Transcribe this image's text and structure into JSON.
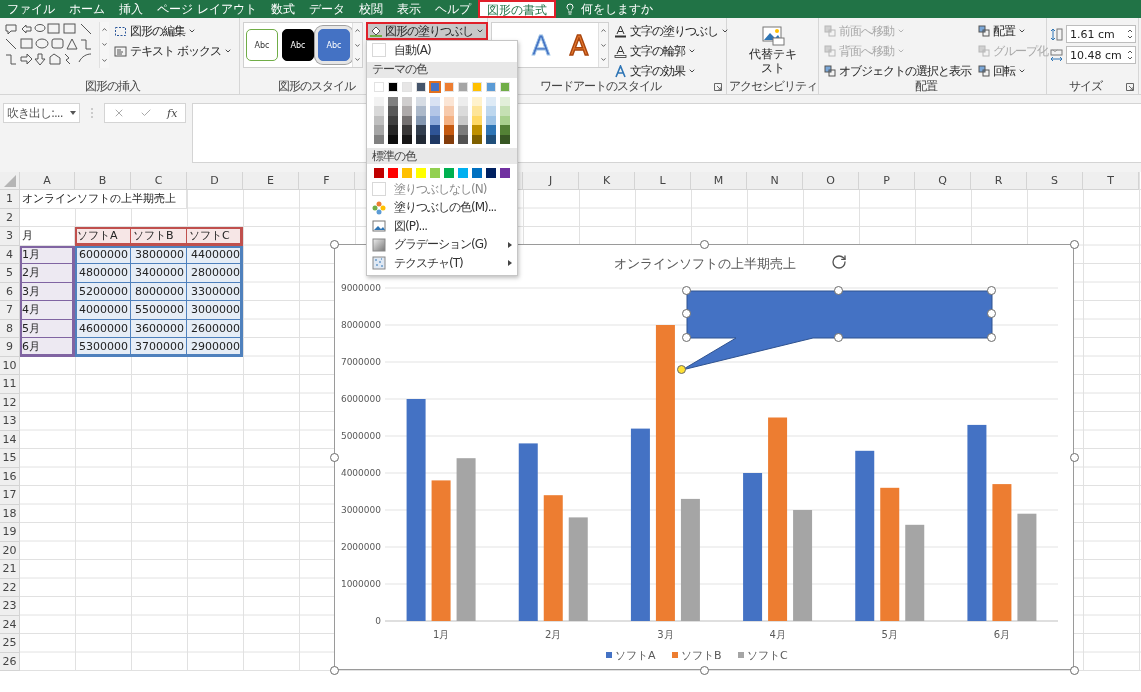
{
  "tabs": [
    {
      "label": "ファイル",
      "selected": false
    },
    {
      "label": "ホーム",
      "selected": false
    },
    {
      "label": "挿入",
      "selected": false
    },
    {
      "label": "ページ レイアウト",
      "selected": false
    },
    {
      "label": "数式",
      "selected": false
    },
    {
      "label": "データ",
      "selected": false
    },
    {
      "label": "校閲",
      "selected": false
    },
    {
      "label": "表示",
      "selected": false
    },
    {
      "label": "ヘルプ",
      "selected": false
    },
    {
      "label": "図形の書式",
      "selected": true
    }
  ],
  "tell_me": "何をしますか",
  "ribbon": {
    "insert_shapes": {
      "label": "図形の挿入",
      "commands": [
        "図形の編集",
        "テキスト ボックス"
      ]
    },
    "shape_styles": {
      "label": "図形のスタイル",
      "presets": [
        {
          "text": "Abc",
          "color": "#ffffff",
          "selected": false
        },
        {
          "text": "Abc",
          "color": "#000000",
          "selected": false
        },
        {
          "text": "Abc",
          "color": "#4472c4",
          "selected": true
        }
      ],
      "fill_button": {
        "label": "図形の塗りつぶし",
        "open": true
      }
    },
    "wordart": {
      "label": "ワードアートのスタイル",
      "presets": [
        {
          "text": "A",
          "kind": "fill",
          "color": "#4472c4"
        },
        {
          "text": "A",
          "kind": "outline",
          "color": "#ed7d31"
        }
      ],
      "commands": [
        "文字の塗りつぶし",
        "文字の輪郭",
        "文字の効果"
      ]
    },
    "accessibility": {
      "label": "アクセシビリティ",
      "button": "代替テキスト"
    },
    "arrange": {
      "label": "配置",
      "commands": [
        {
          "label": "前面へ移動",
          "disabled": true,
          "dropdown": true
        },
        {
          "label": "背面へ移動",
          "disabled": true,
          "dropdown": true
        },
        {
          "label": "オブジェクトの選択と表示",
          "disabled": false,
          "dropdown": false
        },
        {
          "label": "配置",
          "disabled": false,
          "dropdown": true
        },
        {
          "label": "グループ化",
          "disabled": true,
          "dropdown": true
        },
        {
          "label": "回転",
          "disabled": false,
          "dropdown": true
        }
      ]
    },
    "size": {
      "label": "サイズ",
      "height": "1.61 cm",
      "width": "10.48 cm"
    }
  },
  "formula_bar": {
    "name_box": "吹き出し:...",
    "function_label": "fx"
  },
  "fill_menu": {
    "auto": "自動(A)",
    "theme_heading": "テーマの色",
    "theme_colors": [
      {
        "color": "#ffffff",
        "selected": false,
        "shades": [
          {
            "color": "#f2f2f2"
          },
          {
            "color": "#d9d9d9"
          },
          {
            "color": "#bfbfbf"
          },
          {
            "color": "#a6a6a6"
          },
          {
            "color": "#808080"
          }
        ]
      },
      {
        "color": "#000000",
        "selected": false,
        "shades": [
          {
            "color": "#808080"
          },
          {
            "color": "#595959"
          },
          {
            "color": "#404040"
          },
          {
            "color": "#262626"
          },
          {
            "color": "#0d0d0d"
          }
        ]
      },
      {
        "color": "#e7e6e6",
        "selected": false,
        "shades": [
          {
            "color": "#d0cece"
          },
          {
            "color": "#aeaaaa"
          },
          {
            "color": "#757171"
          },
          {
            "color": "#3a3838"
          },
          {
            "color": "#171616"
          }
        ]
      },
      {
        "color": "#44546a",
        "selected": false,
        "shades": [
          {
            "color": "#d6dce4"
          },
          {
            "color": "#acb9ca"
          },
          {
            "color": "#8497b0"
          },
          {
            "color": "#333f4f"
          },
          {
            "color": "#222a35"
          }
        ]
      },
      {
        "color": "#4472c4",
        "selected": true,
        "shades": [
          {
            "color": "#d9e2f3"
          },
          {
            "color": "#b4c6e7"
          },
          {
            "color": "#8eaadb"
          },
          {
            "color": "#2f5496"
          },
          {
            "color": "#1f3864"
          }
        ]
      },
      {
        "color": "#ed7d31",
        "selected": false,
        "shades": [
          {
            "color": "#fbe5d5"
          },
          {
            "color": "#f7caac"
          },
          {
            "color": "#f4b183"
          },
          {
            "color": "#c55a11"
          },
          {
            "color": "#833c0b"
          }
        ]
      },
      {
        "color": "#a5a5a5",
        "selected": false,
        "shades": [
          {
            "color": "#ededed"
          },
          {
            "color": "#dbdbdb"
          },
          {
            "color": "#c9c9c9"
          },
          {
            "color": "#7b7b7b"
          },
          {
            "color": "#525252"
          }
        ]
      },
      {
        "color": "#ffc000",
        "selected": false,
        "shades": [
          {
            "color": "#fff2cc"
          },
          {
            "color": "#fee599"
          },
          {
            "color": "#ffd965"
          },
          {
            "color": "#bf9000"
          },
          {
            "color": "#7f6000"
          }
        ]
      },
      {
        "color": "#5b9bd5",
        "selected": false,
        "shades": [
          {
            "color": "#deebf6"
          },
          {
            "color": "#bdd7ee"
          },
          {
            "color": "#9dc3e6"
          },
          {
            "color": "#2e75b5"
          },
          {
            "color": "#1f4e79"
          }
        ]
      },
      {
        "color": "#70ad47",
        "selected": false,
        "shades": [
          {
            "color": "#e2efd9"
          },
          {
            "color": "#c5e0b3"
          },
          {
            "color": "#a8d08d"
          },
          {
            "color": "#538135"
          },
          {
            "color": "#375623"
          }
        ]
      }
    ],
    "standard_heading": "標準の色",
    "standard_colors": [
      {
        "color": "#c00000"
      },
      {
        "color": "#ff0000"
      },
      {
        "color": "#ffc000"
      },
      {
        "color": "#ffff00"
      },
      {
        "color": "#92d050"
      },
      {
        "color": "#00b050"
      },
      {
        "color": "#00b0f0"
      },
      {
        "color": "#0070c0"
      },
      {
        "color": "#002060"
      },
      {
        "color": "#7030a0"
      }
    ],
    "items": [
      {
        "label": "塗りつぶしなし(N)",
        "kind": "no-fill",
        "submenu": false,
        "disabled": true
      },
      {
        "label": "塗りつぶしの色(M)...",
        "kind": "more-colors",
        "submenu": false,
        "disabled": false
      },
      {
        "label": "図(P)...",
        "kind": "picture",
        "submenu": false,
        "disabled": false
      },
      {
        "label": "グラデーション(G)",
        "kind": "gradient",
        "submenu": true,
        "disabled": false
      },
      {
        "label": "テクスチャ(T)",
        "kind": "texture",
        "submenu": true,
        "disabled": false
      }
    ]
  },
  "sheet": {
    "columns_left": [
      "A",
      "B",
      "C",
      "D",
      "E",
      "F"
    ],
    "columns_right": [
      "J",
      "K",
      "L",
      "M",
      "N",
      "O",
      "P",
      "Q",
      "R",
      "S",
      "T"
    ],
    "rows": [
      {
        "number": "1",
        "cells": [
          {
            "text": "オンラインソフトの上半期売上",
            "kind": "text"
          }
        ]
      },
      {
        "number": "2"
      },
      {
        "number": "3",
        "cells": [
          {
            "text": "月",
            "kind": "text"
          },
          {
            "text": "ソフトA",
            "kind": "text",
            "color": "#c0504d"
          },
          {
            "text": "ソフトB",
            "kind": "text",
            "color": "#c0504d"
          },
          {
            "text": "ソフトC",
            "kind": "text",
            "color": "#c0504d"
          }
        ]
      },
      {
        "number": "4",
        "cells": [
          {
            "text": "1月",
            "kind": "text",
            "color": "#8064a2"
          },
          {
            "text": "6000000",
            "kind": "number",
            "color": "#4f81bd"
          },
          {
            "text": "3800000",
            "kind": "number",
            "color": "#4f81bd"
          },
          {
            "text": "4400000",
            "kind": "number",
            "color": "#4f81bd"
          }
        ]
      },
      {
        "number": "5",
        "cells": [
          {
            "text": "2月",
            "kind": "text",
            "color": "#8064a2"
          },
          {
            "text": "4800000",
            "kind": "number",
            "color": "#4f81bd"
          },
          {
            "text": "3400000",
            "kind": "number",
            "color": "#4f81bd"
          },
          {
            "text": "2800000",
            "kind": "number",
            "color": "#4f81bd"
          }
        ]
      },
      {
        "number": "6",
        "cells": [
          {
            "text": "3月",
            "kind": "text",
            "color": "#8064a2"
          },
          {
            "text": "5200000",
            "kind": "number",
            "color": "#4f81bd"
          },
          {
            "text": "8000000",
            "kind": "number",
            "color": "#4f81bd"
          },
          {
            "text": "3300000",
            "kind": "number",
            "color": "#4f81bd"
          }
        ]
      },
      {
        "number": "7",
        "cells": [
          {
            "text": "4月",
            "kind": "text",
            "color": "#8064a2"
          },
          {
            "text": "4000000",
            "kind": "number",
            "color": "#4f81bd"
          },
          {
            "text": "5500000",
            "kind": "number",
            "color": "#4f81bd"
          },
          {
            "text": "3000000",
            "kind": "number",
            "color": "#4f81bd"
          }
        ]
      },
      {
        "number": "8",
        "cells": [
          {
            "text": "5月",
            "kind": "text",
            "color": "#8064a2"
          },
          {
            "text": "4600000",
            "kind": "number",
            "color": "#4f81bd"
          },
          {
            "text": "3600000",
            "kind": "number",
            "color": "#4f81bd"
          },
          {
            "text": "2600000",
            "kind": "number",
            "color": "#4f81bd"
          }
        ]
      },
      {
        "number": "9",
        "cells": [
          {
            "text": "6月",
            "kind": "text",
            "color": "#8064a2"
          },
          {
            "text": "5300000",
            "kind": "number",
            "color": "#4f81bd"
          },
          {
            "text": "3700000",
            "kind": "number",
            "color": "#4f81bd"
          },
          {
            "text": "2900000",
            "kind": "number",
            "color": "#4f81bd"
          }
        ]
      },
      {
        "number": "10"
      },
      {
        "number": "11"
      },
      {
        "number": "12"
      },
      {
        "number": "13"
      },
      {
        "number": "14"
      },
      {
        "number": "15"
      },
      {
        "number": "16"
      },
      {
        "number": "17"
      },
      {
        "number": "18"
      },
      {
        "number": "19"
      },
      {
        "number": "20"
      },
      {
        "number": "21"
      },
      {
        "number": "22"
      },
      {
        "number": "23"
      },
      {
        "number": "24"
      },
      {
        "number": "25"
      },
      {
        "number": "26"
      }
    ]
  },
  "chart": {
    "selected": true,
    "chart_data": {
      "type": "bar",
      "title": "オンラインソフトの上半期売上",
      "categories": [
        "1月",
        "2月",
        "3月",
        "4月",
        "5月",
        "6月"
      ],
      "series": [
        {
          "name": "ソフトA",
          "color": "#4472c4",
          "values": [
            6000000,
            4800000,
            5200000,
            4000000,
            4600000,
            5300000
          ]
        },
        {
          "name": "ソフトB",
          "color": "#ed7d31",
          "values": [
            3800000,
            3400000,
            8000000,
            5500000,
            3600000,
            3700000
          ]
        },
        {
          "name": "ソフトC",
          "color": "#a5a5a5",
          "values": [
            4400000,
            2800000,
            3300000,
            3000000,
            2600000,
            2900000
          ]
        }
      ],
      "ylim": [
        0,
        9000000
      ],
      "yticks": [
        {
          "value": 0,
          "label": "0"
        },
        {
          "value": 1000000,
          "label": "1000000"
        },
        {
          "value": 2000000,
          "label": "2000000"
        },
        {
          "value": 3000000,
          "label": "3000000"
        },
        {
          "value": 4000000,
          "label": "4000000"
        },
        {
          "value": 5000000,
          "label": "5000000"
        },
        {
          "value": 6000000,
          "label": "6000000"
        },
        {
          "value": 7000000,
          "label": "7000000"
        },
        {
          "value": 8000000,
          "label": "8000000"
        },
        {
          "value": 9000000,
          "label": "9000000"
        }
      ],
      "grid": true,
      "legend": true
    },
    "callout": {
      "color": "#4472c4",
      "selected": true
    }
  }
}
